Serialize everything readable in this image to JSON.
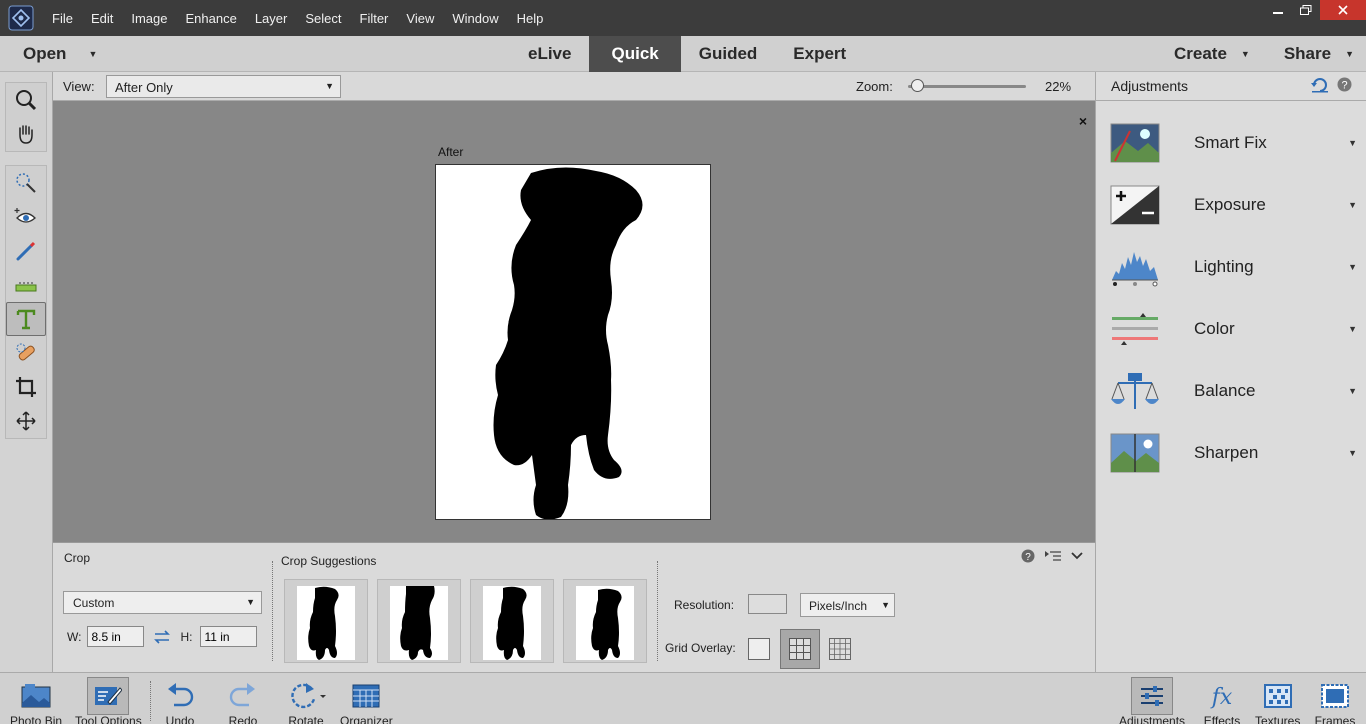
{
  "menubar": {
    "items": [
      "File",
      "Edit",
      "Image",
      "Enhance",
      "Layer",
      "Select",
      "Filter",
      "View",
      "Window",
      "Help"
    ]
  },
  "modebar": {
    "open_label": "Open",
    "modes": [
      "eLive",
      "Quick",
      "Guided",
      "Expert"
    ],
    "active_mode": "Quick",
    "create_label": "Create",
    "share_label": "Share"
  },
  "viewbar": {
    "view_label": "View:",
    "view_value": "After Only",
    "zoom_label": "Zoom:",
    "zoom_value": "22%",
    "zoom_fraction": 0.03
  },
  "canvas": {
    "after_label": "After",
    "close_glyph": "×"
  },
  "options": {
    "title": "Crop",
    "preset_value": "Custom",
    "width_label": "W:",
    "width_value": "8.5 in",
    "height_label": "H:",
    "height_value": "11 in",
    "suggestions_title": "Crop Suggestions",
    "resolution_label": "Resolution:",
    "resolution_value": "",
    "units_value": "Pixels/Inch",
    "grid_overlay_label": "Grid Overlay:"
  },
  "adjustments": {
    "title": "Adjustments",
    "items": [
      {
        "label": "Smart Fix",
        "icon": "smart-fix-icon"
      },
      {
        "label": "Exposure",
        "icon": "exposure-icon"
      },
      {
        "label": "Lighting",
        "icon": "lighting-icon"
      },
      {
        "label": "Color",
        "icon": "color-icon"
      },
      {
        "label": "Balance",
        "icon": "balance-icon"
      },
      {
        "label": "Sharpen",
        "icon": "sharpen-icon"
      }
    ]
  },
  "taskbar": {
    "photo_bin": "Photo Bin",
    "tool_options": "Tool Options",
    "undo": "Undo",
    "redo": "Redo",
    "rotate": "Rotate",
    "organizer": "Organizer",
    "adjustments": "Adjustments",
    "effects": "Effects",
    "textures": "Textures",
    "frames": "Frames"
  },
  "colors": {
    "menubar_bg": "#3c3c3c",
    "active_mode_bg": "#4d4d4d",
    "canvas_bg": "#878787",
    "accent_blue": "#2f6db5"
  }
}
